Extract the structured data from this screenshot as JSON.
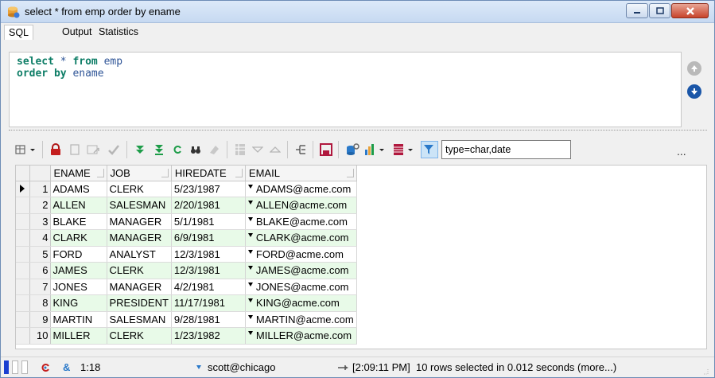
{
  "window": {
    "title": "select * from emp order by ename"
  },
  "tabs": [
    {
      "label": "SQL",
      "active": true
    },
    {
      "label": "Output",
      "active": false
    },
    {
      "label": "Statistics",
      "active": false
    }
  ],
  "editor": {
    "line1": {
      "kw1": "select",
      "op": " * ",
      "kw2": "from",
      "rest": " emp"
    },
    "line2": {
      "kw1": "order by",
      "rest": " ename"
    }
  },
  "toolbar": {
    "filter_value": "type=char,date",
    "more_label": "..."
  },
  "grid": {
    "columns": [
      "ENAME",
      "JOB",
      "HIREDATE",
      "EMAIL"
    ],
    "rows": [
      {
        "n": "1",
        "ename": "ADAMS",
        "job": "CLERK",
        "hiredate": "5/23/1987",
        "email": "ADAMS@acme.com"
      },
      {
        "n": "2",
        "ename": "ALLEN",
        "job": "SALESMAN",
        "hiredate": "2/20/1981",
        "email": "ALLEN@acme.com"
      },
      {
        "n": "3",
        "ename": "BLAKE",
        "job": "MANAGER",
        "hiredate": "5/1/1981",
        "email": "BLAKE@acme.com"
      },
      {
        "n": "4",
        "ename": "CLARK",
        "job": "MANAGER",
        "hiredate": "6/9/1981",
        "email": "CLARK@acme.com"
      },
      {
        "n": "5",
        "ename": "FORD",
        "job": "ANALYST",
        "hiredate": "12/3/1981",
        "email": "FORD@acme.com"
      },
      {
        "n": "6",
        "ename": "JAMES",
        "job": "CLERK",
        "hiredate": "12/3/1981",
        "email": "JAMES@acme.com"
      },
      {
        "n": "7",
        "ename": "JONES",
        "job": "MANAGER",
        "hiredate": "4/2/1981",
        "email": "JONES@acme.com"
      },
      {
        "n": "8",
        "ename": "KING",
        "job": "PRESIDENT",
        "hiredate": "11/17/1981",
        "email": "KING@acme.com"
      },
      {
        "n": "9",
        "ename": "MARTIN",
        "job": "SALESMAN",
        "hiredate": "9/28/1981",
        "email": "MARTIN@acme.com"
      },
      {
        "n": "10",
        "ename": "MILLER",
        "job": "CLERK",
        "hiredate": "1/23/1982",
        "email": "MILLER@acme.com"
      }
    ]
  },
  "statusbar": {
    "cursor": "1:18",
    "connection": "scott@chicago",
    "message": "[2:09:11 PM]  10 rows selected in 0.012 seconds (more...)"
  },
  "colors": {
    "keyword": "#0d7d66",
    "identifier": "#2f5597",
    "alt_row": "#e8fae8",
    "accent_blue": "#1a56a8"
  }
}
